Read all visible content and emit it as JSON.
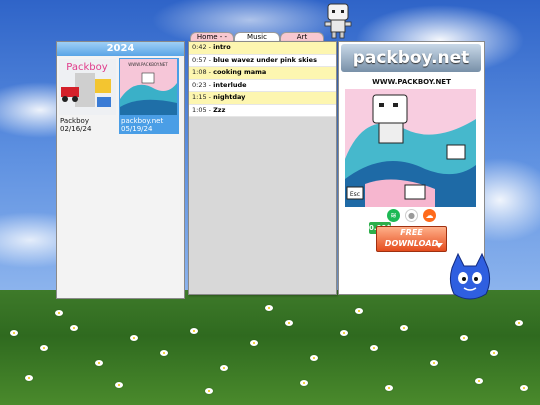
{
  "year_panel": {
    "year": "2024",
    "albums": [
      {
        "title": "Packboy",
        "date": "02/16/24",
        "cover_text": "Packboy"
      },
      {
        "title": "packboy.net",
        "date": "05/19/24",
        "cover_text": "WWW.PACKBOY.NET"
      }
    ]
  },
  "tabs": [
    {
      "label": "Home - -"
    },
    {
      "label": "Music"
    },
    {
      "label": "Art"
    }
  ],
  "tracks": [
    {
      "time": "0:42",
      "title": "intro",
      "highlight": true
    },
    {
      "time": "0:57",
      "title": "blue wavez under pink skies",
      "highlight": false
    },
    {
      "time": "1:08",
      "title": "cooking mama",
      "highlight": true
    },
    {
      "time": "0:23",
      "title": "interlude",
      "highlight": false
    },
    {
      "time": "1:15",
      "title": "nightday",
      "highlight": true
    },
    {
      "time": "1:05",
      "title": "Zzz",
      "highlight": false
    }
  ],
  "album_panel": {
    "logo": "packboy.net",
    "url": "WWW.PACKBOY.NET",
    "cover_key": "Esc",
    "services": [
      {
        "name": "spotify-icon",
        "glyph": "≋",
        "color": "#1db954"
      },
      {
        "name": "apple-icon",
        "glyph": "●",
        "color": "#9a9a9a"
      },
      {
        "name": "soundcloud-icon",
        "glyph": "☁",
        "color": "#ff6a1a"
      }
    ],
    "price": "0.00$",
    "download_line1": "FREE",
    "download_line2": "DOWNLOAD"
  },
  "colors": {
    "accent_blue": "#4a9ee6",
    "highlight_yellow": "#fdf6b0",
    "download_orange": "#e54d1e",
    "price_green": "#2cae4a"
  }
}
